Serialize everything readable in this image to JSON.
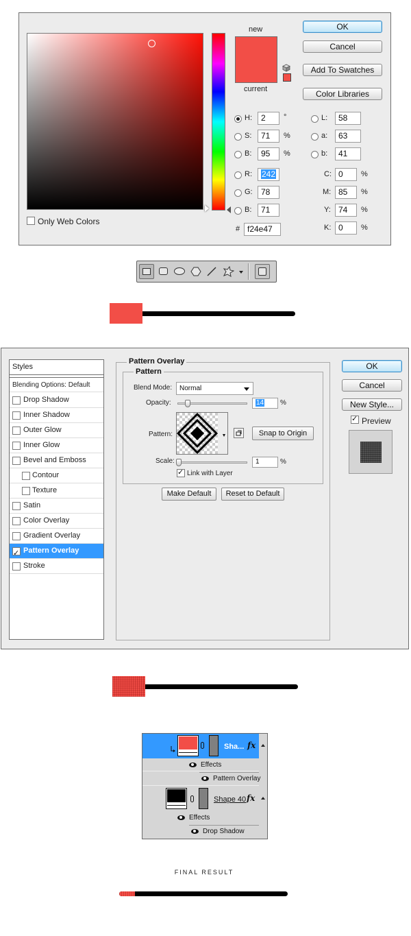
{
  "color_picker": {
    "new_label": "new",
    "current_label": "current",
    "new_color": "#f24e47",
    "buttons": {
      "ok": "OK",
      "cancel": "Cancel",
      "add_to_swatches": "Add To Swatches",
      "color_libraries": "Color Libraries"
    },
    "hsb": [
      {
        "key": "H:",
        "value": "2",
        "unit": "°"
      },
      {
        "key": "S:",
        "value": "71",
        "unit": "%"
      },
      {
        "key": "B:",
        "value": "95",
        "unit": "%"
      }
    ],
    "rgb": [
      {
        "key": "R:",
        "value": "242"
      },
      {
        "key": "G:",
        "value": "78"
      },
      {
        "key": "B:",
        "value": "71"
      }
    ],
    "lab": [
      {
        "key": "L:",
        "value": "58"
      },
      {
        "key": "a:",
        "value": "63"
      },
      {
        "key": "b:",
        "value": "41"
      }
    ],
    "cmyk": [
      {
        "key": "C:",
        "value": "0",
        "unit": "%"
      },
      {
        "key": "M:",
        "value": "85",
        "unit": "%"
      },
      {
        "key": "Y:",
        "value": "74",
        "unit": "%"
      },
      {
        "key": "K:",
        "value": "0",
        "unit": "%"
      }
    ],
    "hex_label": "#",
    "hex_value": "f24e47",
    "only_web_colors": "Only Web Colors"
  },
  "layer_style": {
    "styles_header": "Styles",
    "blending_options": "Blending Options: Default",
    "items": [
      "Drop Shadow",
      "Inner Shadow",
      "Outer Glow",
      "Inner Glow",
      "Bevel and Emboss",
      "Contour",
      "Texture",
      "Satin",
      "Color Overlay",
      "Gradient Overlay",
      "Pattern Overlay",
      "Stroke"
    ],
    "active_item": "Pattern Overlay",
    "section_title": "Pattern Overlay",
    "subsection_title": "Pattern",
    "blend_mode_label": "Blend Mode:",
    "blend_mode_value": "Normal",
    "opacity_label": "Opacity:",
    "opacity_value": "14",
    "opacity_unit": "%",
    "pattern_label": "Pattern:",
    "snap_button": "Snap to Origin",
    "scale_label": "Scale:",
    "scale_value": "1",
    "scale_unit": "%",
    "link_with_layer": "Link with Layer",
    "make_default": "Make Default",
    "reset_to_default": "Reset to Default",
    "ok": "OK",
    "cancel": "Cancel",
    "new_style": "New Style...",
    "preview": "Preview"
  },
  "layers_panel": {
    "layer1_name": "Sha...",
    "effects_label": "Effects",
    "layer1_effect": "Pattern Overlay",
    "layer2_name": "Shape 40",
    "layer2_effect": "Drop Shadow",
    "fx": "fx"
  },
  "final_result_label": "FINAL RESULT",
  "colors": {
    "accent": "#f24e47",
    "selection": "#3399ff"
  }
}
